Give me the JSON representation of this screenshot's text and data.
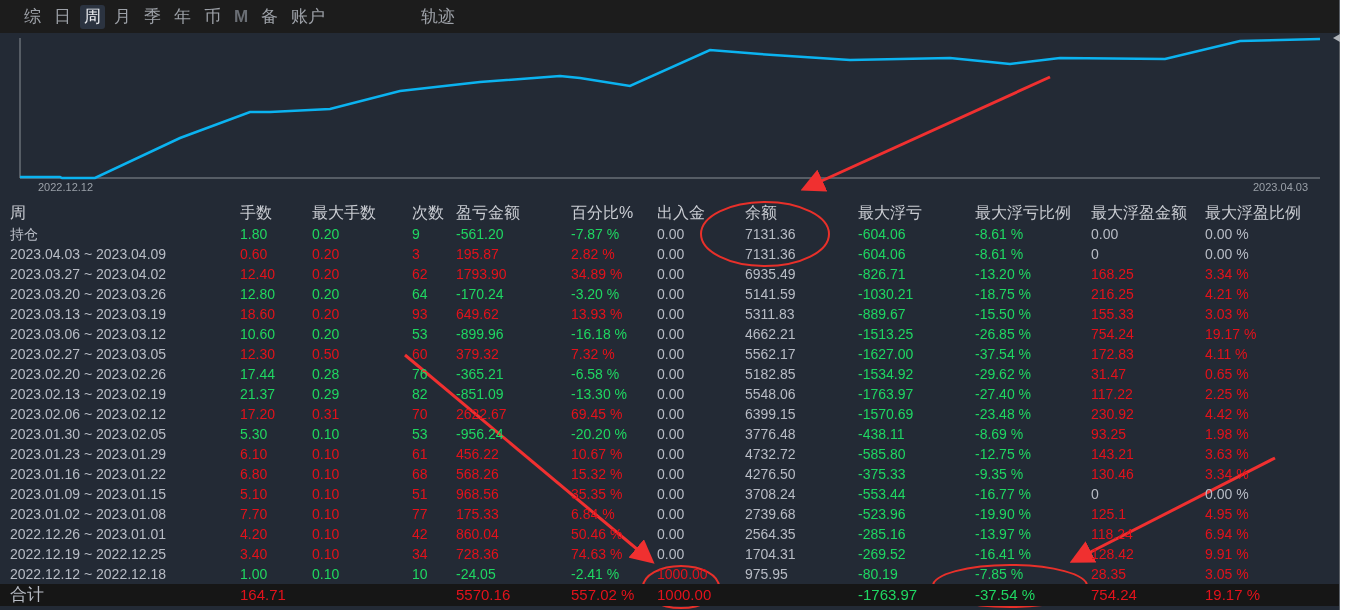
{
  "tabs": [
    {
      "label": "综",
      "selected": false,
      "disabled": false
    },
    {
      "label": "日",
      "selected": false,
      "disabled": false
    },
    {
      "label": "周",
      "selected": true,
      "disabled": false
    },
    {
      "label": "月",
      "selected": false,
      "disabled": false
    },
    {
      "label": "季",
      "selected": false,
      "disabled": false
    },
    {
      "label": "年",
      "selected": false,
      "disabled": false
    },
    {
      "label": "币",
      "selected": false,
      "disabled": false
    },
    {
      "label": "M",
      "selected": false,
      "disabled": true
    },
    {
      "label": "备",
      "selected": false,
      "disabled": false
    },
    {
      "label": "账户",
      "selected": false,
      "disabled": false
    }
  ],
  "track_tab": {
    "label": "轨迹",
    "selected": false
  },
  "chart": {
    "start_label": "2022.12.12",
    "end_label": "2023.04.03"
  },
  "table": {
    "columns": [
      "周",
      "手数",
      "最大手数",
      "次数",
      "盈亏金额",
      "百分比%",
      "出入金",
      "余额",
      "最大浮亏",
      "最大浮亏比例",
      "最大浮盈金额",
      "最大浮盈比例"
    ],
    "rows": [
      {
        "cells": [
          {
            "text": "持仓",
            "color": "#b8bcc5"
          },
          {
            "text": "1.80",
            "color": "#1fd762"
          },
          {
            "text": "0.20",
            "color": "#1fd762"
          },
          {
            "text": "9",
            "color": "#1fd762"
          },
          {
            "text": "-561.20",
            "color": "#1fd762"
          },
          {
            "text": "-7.87 %",
            "color": "#1fd762"
          },
          {
            "text": "0.00",
            "color": "#b8bcc5"
          },
          {
            "text": "7131.36",
            "color": "#b8bcc5"
          },
          {
            "text": "-604.06",
            "color": "#1fd762"
          },
          {
            "text": "-8.61 %",
            "color": "#1fd762"
          },
          {
            "text": "0.00",
            "color": "#b8bcc5"
          },
          {
            "text": "0.00 %",
            "color": "#b8bcc5"
          }
        ]
      },
      {
        "cells": [
          {
            "text": "2023.04.03 ~ 2023.04.09",
            "color": "#b8bcc5"
          },
          {
            "text": "0.60",
            "color": "#e3121b"
          },
          {
            "text": "0.20",
            "color": "#e3121b"
          },
          {
            "text": "3",
            "color": "#e3121b"
          },
          {
            "text": "195.87",
            "color": "#e3121b"
          },
          {
            "text": "2.82 %",
            "color": "#e3121b"
          },
          {
            "text": "0.00",
            "color": "#b8bcc5"
          },
          {
            "text": "7131.36",
            "color": "#b8bcc5"
          },
          {
            "text": "-604.06",
            "color": "#1fd762"
          },
          {
            "text": "-8.61 %",
            "color": "#1fd762"
          },
          {
            "text": "0",
            "color": "#b8bcc5"
          },
          {
            "text": "0.00 %",
            "color": "#b8bcc5"
          }
        ]
      },
      {
        "cells": [
          {
            "text": "2023.03.27 ~ 2023.04.02",
            "color": "#b8bcc5"
          },
          {
            "text": "12.40",
            "color": "#e3121b"
          },
          {
            "text": "0.20",
            "color": "#e3121b"
          },
          {
            "text": "62",
            "color": "#e3121b"
          },
          {
            "text": "1793.90",
            "color": "#e3121b"
          },
          {
            "text": "34.89 %",
            "color": "#e3121b"
          },
          {
            "text": "0.00",
            "color": "#b8bcc5"
          },
          {
            "text": "6935.49",
            "color": "#b8bcc5"
          },
          {
            "text": "-826.71",
            "color": "#1fd762"
          },
          {
            "text": "-13.20 %",
            "color": "#1fd762"
          },
          {
            "text": "168.25",
            "color": "#e3121b"
          },
          {
            "text": "3.34 %",
            "color": "#e3121b"
          }
        ]
      },
      {
        "cells": [
          {
            "text": "2023.03.20 ~ 2023.03.26",
            "color": "#b8bcc5"
          },
          {
            "text": "12.80",
            "color": "#1fd762"
          },
          {
            "text": "0.20",
            "color": "#1fd762"
          },
          {
            "text": "64",
            "color": "#1fd762"
          },
          {
            "text": "-170.24",
            "color": "#1fd762"
          },
          {
            "text": "-3.20 %",
            "color": "#1fd762"
          },
          {
            "text": "0.00",
            "color": "#b8bcc5"
          },
          {
            "text": "5141.59",
            "color": "#b8bcc5"
          },
          {
            "text": "-1030.21",
            "color": "#1fd762"
          },
          {
            "text": "-18.75 %",
            "color": "#1fd762"
          },
          {
            "text": "216.25",
            "color": "#e3121b"
          },
          {
            "text": "4.21 %",
            "color": "#e3121b"
          }
        ]
      },
      {
        "cells": [
          {
            "text": "2023.03.13 ~ 2023.03.19",
            "color": "#b8bcc5"
          },
          {
            "text": "18.60",
            "color": "#e3121b"
          },
          {
            "text": "0.20",
            "color": "#e3121b"
          },
          {
            "text": "93",
            "color": "#e3121b"
          },
          {
            "text": "649.62",
            "color": "#e3121b"
          },
          {
            "text": "13.93 %",
            "color": "#e3121b"
          },
          {
            "text": "0.00",
            "color": "#b8bcc5"
          },
          {
            "text": "5311.83",
            "color": "#b8bcc5"
          },
          {
            "text": "-889.67",
            "color": "#1fd762"
          },
          {
            "text": "-15.50 %",
            "color": "#1fd762"
          },
          {
            "text": "155.33",
            "color": "#e3121b"
          },
          {
            "text": "3.03 %",
            "color": "#e3121b"
          }
        ]
      },
      {
        "cells": [
          {
            "text": "2023.03.06 ~ 2023.03.12",
            "color": "#b8bcc5"
          },
          {
            "text": "10.60",
            "color": "#1fd762"
          },
          {
            "text": "0.20",
            "color": "#1fd762"
          },
          {
            "text": "53",
            "color": "#1fd762"
          },
          {
            "text": "-899.96",
            "color": "#1fd762"
          },
          {
            "text": "-16.18 %",
            "color": "#1fd762"
          },
          {
            "text": "0.00",
            "color": "#b8bcc5"
          },
          {
            "text": "4662.21",
            "color": "#b8bcc5"
          },
          {
            "text": "-1513.25",
            "color": "#1fd762"
          },
          {
            "text": "-26.85 %",
            "color": "#1fd762"
          },
          {
            "text": "754.24",
            "color": "#e3121b"
          },
          {
            "text": "19.17 %",
            "color": "#e3121b"
          }
        ]
      },
      {
        "cells": [
          {
            "text": "2023.02.27 ~ 2023.03.05",
            "color": "#b8bcc5"
          },
          {
            "text": "12.30",
            "color": "#e3121b"
          },
          {
            "text": "0.50",
            "color": "#e3121b"
          },
          {
            "text": "60",
            "color": "#e3121b"
          },
          {
            "text": "379.32",
            "color": "#e3121b"
          },
          {
            "text": "7.32 %",
            "color": "#e3121b"
          },
          {
            "text": "0.00",
            "color": "#b8bcc5"
          },
          {
            "text": "5562.17",
            "color": "#b8bcc5"
          },
          {
            "text": "-1627.00",
            "color": "#1fd762"
          },
          {
            "text": "-37.54 %",
            "color": "#1fd762"
          },
          {
            "text": "172.83",
            "color": "#e3121b"
          },
          {
            "text": "4.11 %",
            "color": "#e3121b"
          }
        ]
      },
      {
        "cells": [
          {
            "text": "2023.02.20 ~ 2023.02.26",
            "color": "#b8bcc5"
          },
          {
            "text": "17.44",
            "color": "#1fd762"
          },
          {
            "text": "0.28",
            "color": "#1fd762"
          },
          {
            "text": "76",
            "color": "#1fd762"
          },
          {
            "text": "-365.21",
            "color": "#1fd762"
          },
          {
            "text": "-6.58 %",
            "color": "#1fd762"
          },
          {
            "text": "0.00",
            "color": "#b8bcc5"
          },
          {
            "text": "5182.85",
            "color": "#b8bcc5"
          },
          {
            "text": "-1534.92",
            "color": "#1fd762"
          },
          {
            "text": "-29.62 %",
            "color": "#1fd762"
          },
          {
            "text": "31.47",
            "color": "#e3121b"
          },
          {
            "text": "0.65 %",
            "color": "#e3121b"
          }
        ]
      },
      {
        "cells": [
          {
            "text": "2023.02.13 ~ 2023.02.19",
            "color": "#b8bcc5"
          },
          {
            "text": "21.37",
            "color": "#1fd762"
          },
          {
            "text": "0.29",
            "color": "#1fd762"
          },
          {
            "text": "82",
            "color": "#1fd762"
          },
          {
            "text": "-851.09",
            "color": "#1fd762"
          },
          {
            "text": "-13.30 %",
            "color": "#1fd762"
          },
          {
            "text": "0.00",
            "color": "#b8bcc5"
          },
          {
            "text": "5548.06",
            "color": "#b8bcc5"
          },
          {
            "text": "-1763.97",
            "color": "#1fd762"
          },
          {
            "text": "-27.40 %",
            "color": "#1fd762"
          },
          {
            "text": "117.22",
            "color": "#e3121b"
          },
          {
            "text": "2.25 %",
            "color": "#e3121b"
          }
        ]
      },
      {
        "cells": [
          {
            "text": "2023.02.06 ~ 2023.02.12",
            "color": "#b8bcc5"
          },
          {
            "text": "17.20",
            "color": "#e3121b"
          },
          {
            "text": "0.31",
            "color": "#e3121b"
          },
          {
            "text": "70",
            "color": "#e3121b"
          },
          {
            "text": "2622.67",
            "color": "#e3121b"
          },
          {
            "text": "69.45 %",
            "color": "#e3121b"
          },
          {
            "text": "0.00",
            "color": "#b8bcc5"
          },
          {
            "text": "6399.15",
            "color": "#b8bcc5"
          },
          {
            "text": "-1570.69",
            "color": "#1fd762"
          },
          {
            "text": "-23.48 %",
            "color": "#1fd762"
          },
          {
            "text": "230.92",
            "color": "#e3121b"
          },
          {
            "text": "4.42 %",
            "color": "#e3121b"
          }
        ]
      },
      {
        "cells": [
          {
            "text": "2023.01.30 ~ 2023.02.05",
            "color": "#b8bcc5"
          },
          {
            "text": "5.30",
            "color": "#1fd762"
          },
          {
            "text": "0.10",
            "color": "#1fd762"
          },
          {
            "text": "53",
            "color": "#1fd762"
          },
          {
            "text": "-956.24",
            "color": "#1fd762"
          },
          {
            "text": "-20.20 %",
            "color": "#1fd762"
          },
          {
            "text": "0.00",
            "color": "#b8bcc5"
          },
          {
            "text": "3776.48",
            "color": "#b8bcc5"
          },
          {
            "text": "-438.11",
            "color": "#1fd762"
          },
          {
            "text": "-8.69 %",
            "color": "#1fd762"
          },
          {
            "text": "93.25",
            "color": "#e3121b"
          },
          {
            "text": "1.98 %",
            "color": "#e3121b"
          }
        ]
      },
      {
        "cells": [
          {
            "text": "2023.01.23 ~ 2023.01.29",
            "color": "#b8bcc5"
          },
          {
            "text": "6.10",
            "color": "#e3121b"
          },
          {
            "text": "0.10",
            "color": "#e3121b"
          },
          {
            "text": "61",
            "color": "#e3121b"
          },
          {
            "text": "456.22",
            "color": "#e3121b"
          },
          {
            "text": "10.67 %",
            "color": "#e3121b"
          },
          {
            "text": "0.00",
            "color": "#b8bcc5"
          },
          {
            "text": "4732.72",
            "color": "#b8bcc5"
          },
          {
            "text": "-585.80",
            "color": "#1fd762"
          },
          {
            "text": "-12.75 %",
            "color": "#1fd762"
          },
          {
            "text": "143.21",
            "color": "#e3121b"
          },
          {
            "text": "3.63 %",
            "color": "#e3121b"
          }
        ]
      },
      {
        "cells": [
          {
            "text": "2023.01.16 ~ 2023.01.22",
            "color": "#b8bcc5"
          },
          {
            "text": "6.80",
            "color": "#e3121b"
          },
          {
            "text": "0.10",
            "color": "#e3121b"
          },
          {
            "text": "68",
            "color": "#e3121b"
          },
          {
            "text": "568.26",
            "color": "#e3121b"
          },
          {
            "text": "15.32 %",
            "color": "#e3121b"
          },
          {
            "text": "0.00",
            "color": "#b8bcc5"
          },
          {
            "text": "4276.50",
            "color": "#b8bcc5"
          },
          {
            "text": "-375.33",
            "color": "#1fd762"
          },
          {
            "text": "-9.35 %",
            "color": "#1fd762"
          },
          {
            "text": "130.46",
            "color": "#e3121b"
          },
          {
            "text": "3.34 %",
            "color": "#e3121b"
          }
        ]
      },
      {
        "cells": [
          {
            "text": "2023.01.09 ~ 2023.01.15",
            "color": "#b8bcc5"
          },
          {
            "text": "5.10",
            "color": "#e3121b"
          },
          {
            "text": "0.10",
            "color": "#e3121b"
          },
          {
            "text": "51",
            "color": "#e3121b"
          },
          {
            "text": "968.56",
            "color": "#e3121b"
          },
          {
            "text": "35.35 %",
            "color": "#e3121b"
          },
          {
            "text": "0.00",
            "color": "#b8bcc5"
          },
          {
            "text": "3708.24",
            "color": "#b8bcc5"
          },
          {
            "text": "-553.44",
            "color": "#1fd762"
          },
          {
            "text": "-16.77 %",
            "color": "#1fd762"
          },
          {
            "text": "0",
            "color": "#b8bcc5"
          },
          {
            "text": "0.00 %",
            "color": "#b8bcc5"
          }
        ]
      },
      {
        "cells": [
          {
            "text": "2023.01.02 ~ 2023.01.08",
            "color": "#b8bcc5"
          },
          {
            "text": "7.70",
            "color": "#e3121b"
          },
          {
            "text": "0.10",
            "color": "#e3121b"
          },
          {
            "text": "77",
            "color": "#e3121b"
          },
          {
            "text": "175.33",
            "color": "#e3121b"
          },
          {
            "text": "6.84 %",
            "color": "#e3121b"
          },
          {
            "text": "0.00",
            "color": "#b8bcc5"
          },
          {
            "text": "2739.68",
            "color": "#b8bcc5"
          },
          {
            "text": "-523.96",
            "color": "#1fd762"
          },
          {
            "text": "-19.90 %",
            "color": "#1fd762"
          },
          {
            "text": "125.1",
            "color": "#e3121b"
          },
          {
            "text": "4.95 %",
            "color": "#e3121b"
          }
        ]
      },
      {
        "cells": [
          {
            "text": "2022.12.26 ~ 2023.01.01",
            "color": "#b8bcc5"
          },
          {
            "text": "4.20",
            "color": "#e3121b"
          },
          {
            "text": "0.10",
            "color": "#e3121b"
          },
          {
            "text": "42",
            "color": "#e3121b"
          },
          {
            "text": "860.04",
            "color": "#e3121b"
          },
          {
            "text": "50.46 %",
            "color": "#e3121b"
          },
          {
            "text": "0.00",
            "color": "#b8bcc5"
          },
          {
            "text": "2564.35",
            "color": "#b8bcc5"
          },
          {
            "text": "-285.16",
            "color": "#1fd762"
          },
          {
            "text": "-13.97 %",
            "color": "#1fd762"
          },
          {
            "text": "118.24",
            "color": "#e3121b"
          },
          {
            "text": "6.94 %",
            "color": "#e3121b"
          }
        ]
      },
      {
        "cells": [
          {
            "text": "2022.12.19 ~ 2022.12.25",
            "color": "#b8bcc5"
          },
          {
            "text": "3.40",
            "color": "#e3121b"
          },
          {
            "text": "0.10",
            "color": "#e3121b"
          },
          {
            "text": "34",
            "color": "#e3121b"
          },
          {
            "text": "728.36",
            "color": "#e3121b"
          },
          {
            "text": "74.63 %",
            "color": "#e3121b"
          },
          {
            "text": "0.00",
            "color": "#b8bcc5"
          },
          {
            "text": "1704.31",
            "color": "#b8bcc5"
          },
          {
            "text": "-269.52",
            "color": "#1fd762"
          },
          {
            "text": "-16.41 %",
            "color": "#1fd762"
          },
          {
            "text": "128.42",
            "color": "#e3121b"
          },
          {
            "text": "9.91 %",
            "color": "#e3121b"
          }
        ]
      },
      {
        "cells": [
          {
            "text": "2022.12.12 ~ 2022.12.18",
            "color": "#b8bcc5"
          },
          {
            "text": "1.00",
            "color": "#1fd762"
          },
          {
            "text": "0.10",
            "color": "#1fd762"
          },
          {
            "text": "10",
            "color": "#1fd762"
          },
          {
            "text": "-24.05",
            "color": "#1fd762"
          },
          {
            "text": "-2.41 %",
            "color": "#1fd762"
          },
          {
            "text": "1000.00",
            "color": "#e3121b"
          },
          {
            "text": "975.95",
            "color": "#b8bcc5"
          },
          {
            "text": "-80.19",
            "color": "#1fd762"
          },
          {
            "text": "-7.85 %",
            "color": "#1fd762"
          },
          {
            "text": "28.35",
            "color": "#e3121b"
          },
          {
            "text": "3.05 %",
            "color": "#e3121b"
          }
        ]
      }
    ],
    "total": {
      "label": {
        "text": "合计",
        "color": "#b8bcc5"
      },
      "lots": {
        "text": "164.71",
        "color": "#e3121b"
      },
      "profit": {
        "text": "5570.16",
        "color": "#e3121b"
      },
      "percent": {
        "text": "557.02 %",
        "color": "#e3121b"
      },
      "deposit": {
        "text": "1000.00",
        "color": "#e3121b"
      },
      "max_float_loss": {
        "text": "-1763.97",
        "color": "#1fd762"
      },
      "max_float_loss_ratio": {
        "text": "-37.54 %",
        "color": "#1fd762"
      },
      "max_float_gain": {
        "text": "754.24",
        "color": "#e3121b"
      },
      "max_float_gain_ratio": {
        "text": "19.17 %",
        "color": "#e3121b"
      }
    }
  }
}
